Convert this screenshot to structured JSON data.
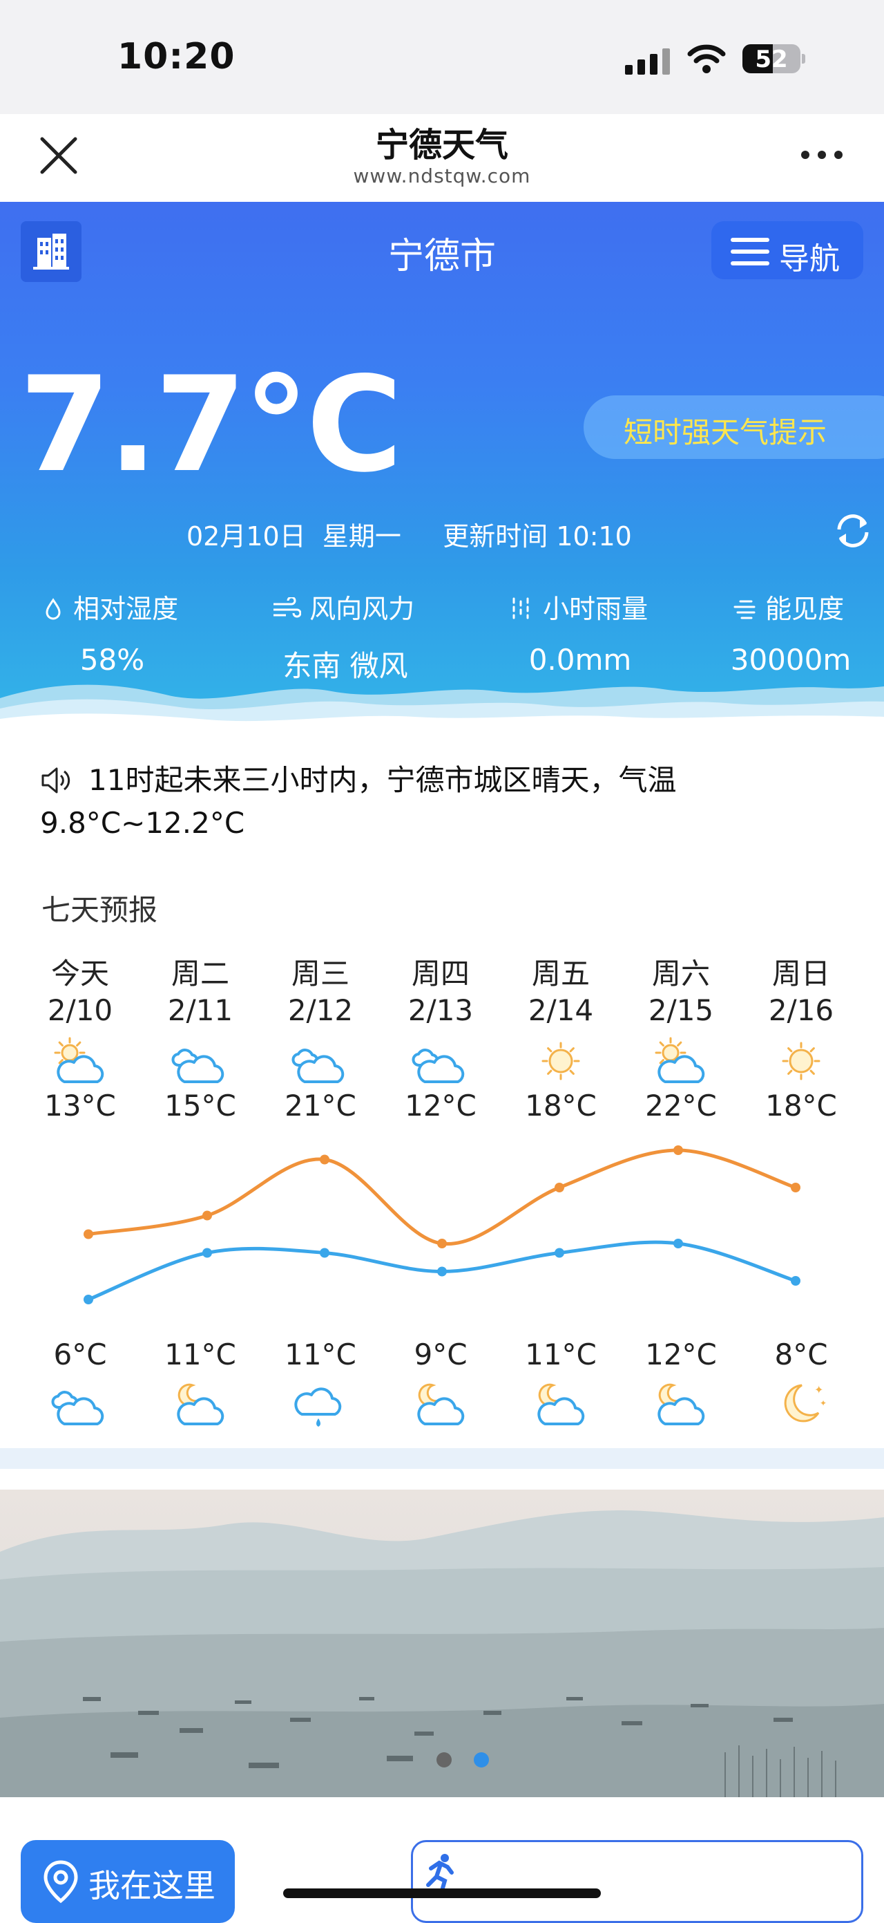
{
  "status": {
    "time": "10:20",
    "battery": "52",
    "battery_level": 0.52
  },
  "browser": {
    "title": "宁德天气",
    "url": "www.ndstqw.com"
  },
  "hero": {
    "city": "宁德市",
    "nav_label": "导航",
    "temperature": "7.7°C",
    "alert_label": "短时强天气提示",
    "dateline": "02月10日  星期一     更新时间 10:10",
    "metrics": [
      {
        "icon": "droplet-icon",
        "label": "相对湿度",
        "value": "58%"
      },
      {
        "icon": "wind-icon",
        "label": "风向风力",
        "value": "东南 微风"
      },
      {
        "icon": "rain-icon",
        "label": "小时雨量",
        "value": "0.0mm"
      },
      {
        "icon": "visibility-icon",
        "label": "能见度",
        "value": "30000m"
      }
    ]
  },
  "summary": "11时起未来三小时内，宁德市城区晴天，气温9.8°C~12.2°C",
  "forecast": {
    "title": "七天预报",
    "days": [
      {
        "name": "今天",
        "date": "2/10",
        "day_icon": "partly-cloudy-day-icon",
        "high": "13°C",
        "low": "6°C",
        "night_icon": "partly-cloudy-icon"
      },
      {
        "name": "周二",
        "date": "2/11",
        "day_icon": "partly-cloudy-icon",
        "high": "15°C",
        "low": "11°C",
        "night_icon": "partly-cloudy-night-icon"
      },
      {
        "name": "周三",
        "date": "2/12",
        "day_icon": "partly-cloudy-icon",
        "high": "21°C",
        "low": "11°C",
        "night_icon": "light-rain-icon"
      },
      {
        "name": "周四",
        "date": "2/13",
        "day_icon": "partly-cloudy-icon",
        "high": "12°C",
        "low": "9°C",
        "night_icon": "partly-cloudy-night-icon"
      },
      {
        "name": "周五",
        "date": "2/14",
        "day_icon": "sunny-icon",
        "high": "18°C",
        "low": "11°C",
        "night_icon": "partly-cloudy-night-icon"
      },
      {
        "name": "周六",
        "date": "2/15",
        "day_icon": "partly-cloudy-day-icon",
        "high": "22°C",
        "low": "12°C",
        "night_icon": "partly-cloudy-night-icon"
      },
      {
        "name": "周日",
        "date": "2/16",
        "day_icon": "sunny-icon",
        "high": "18°C",
        "low": "8°C",
        "night_icon": "clear-night-icon"
      }
    ]
  },
  "chart_data": {
    "type": "line",
    "categories": [
      "2/10",
      "2/11",
      "2/12",
      "2/13",
      "2/14",
      "2/15",
      "2/16"
    ],
    "series": [
      {
        "values": [
          13,
          15,
          21,
          12,
          18,
          22,
          18
        ],
        "color": "#f0923a"
      },
      {
        "values": [
          6,
          11,
          11,
          9,
          11,
          12,
          8
        ],
        "color": "#3aa6ea"
      }
    ]
  },
  "banner": {
    "active_slide": 2,
    "slide_count": 2
  },
  "bottom": {
    "locate_label": "我在这里"
  }
}
